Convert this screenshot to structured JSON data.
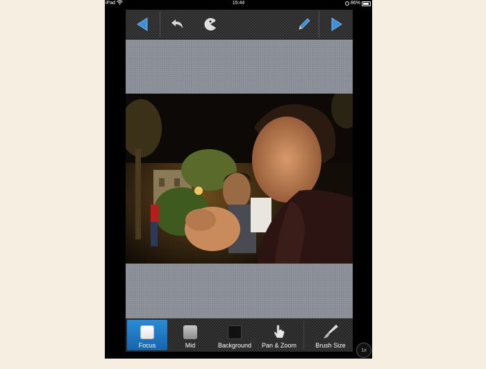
{
  "status_bar": {
    "carrier": "iPad",
    "time": "15:44",
    "battery": "86%",
    "wifi_icon": "wifi-icon",
    "battery_icon": "battery-icon",
    "lock_icon": "rotation-lock-icon"
  },
  "toolbar": {
    "buttons": [
      {
        "name": "back",
        "icon": "left-arrow-icon"
      },
      {
        "name": "undo",
        "icon": "undo-icon"
      },
      {
        "name": "pacman",
        "icon": "pacman-icon"
      },
      {
        "name": "edit",
        "icon": "pencil-icon"
      },
      {
        "name": "forward",
        "icon": "right-arrow-icon"
      }
    ],
    "accent_color": "#3f8fd6"
  },
  "bottom_tabs": [
    {
      "label": "Focus",
      "icon": "focus-swatch-icon",
      "active": true
    },
    {
      "label": "Mid",
      "icon": "mid-swatch-icon",
      "active": false
    },
    {
      "label": "Background",
      "icon": "background-swatch-icon",
      "active": false
    },
    {
      "label": "Pan & Zoom",
      "icon": "hand-icon",
      "active": false
    },
    {
      "label": "Brush Size",
      "icon": "brush-icon",
      "active": false
    }
  ],
  "zoom_level": "1x",
  "colors": {
    "active_tab": "#1f7ac4",
    "canvas_bg": "#8b8f98",
    "page_bg": "#f6efe1"
  }
}
